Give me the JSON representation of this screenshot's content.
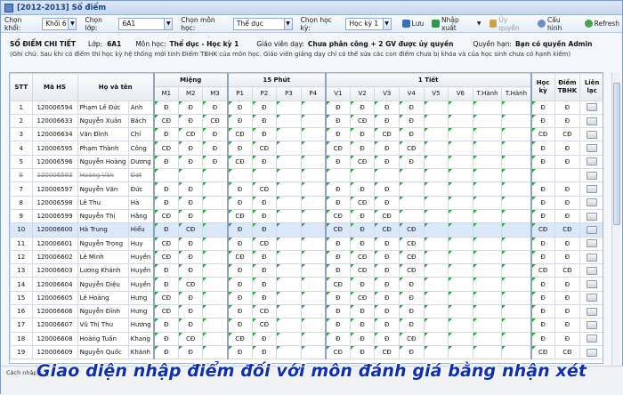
{
  "window": {
    "title": "[2012-2013] Sổ điểm"
  },
  "toolbar": {
    "khoi_label": "Chọn khối:",
    "khoi_value": "Khối 6",
    "lop_label": "Chọn lớp:",
    "lop_value": "6A1",
    "mon_label": "Chọn môn học:",
    "mon_value": "Thể dục",
    "hk_label": "Chọn học kỳ:",
    "hk_value": "Học kỳ 1",
    "save_label": "Lưu",
    "import_label": "Nhập xuất",
    "delegate_label": "Ủy quyền",
    "config_label": "Cấu hình",
    "refresh_label": "Refresh"
  },
  "info": {
    "heading": "SỔ ĐIỂM CHI TIẾT",
    "lop_label": "Lớp:",
    "lop_value": "6A1",
    "mon_label": "Môn học:",
    "mon_value": "Thể dục - Học kỳ 1",
    "gv_label": "Giáo viên dạy:",
    "gv_value": "Chưa phân công + 2 GV được ủy quyền",
    "quyen_label": "Quyền hạn:",
    "quyen_value": "Bạn có quyền Admin",
    "note": "(Ghi chú: Sau khi có điểm thi học kỳ hệ thống mới tính Điểm TBHK của môn học. Giáo viên giảng dạy chỉ có thể sửa các con điểm chưa bị khóa và của học sinh chưa có hạnh kiểm)"
  },
  "table": {
    "groups": {
      "stt": "STT",
      "mahs": "Mã HS",
      "hoten": "Họ và tên",
      "mieng": "Miệng",
      "phut15": "15 Phút",
      "tiet1": "1 Tiết",
      "hocky": "Học kỳ",
      "tbhk": "Điểm TBHK",
      "lienlac": "Liên lạc"
    },
    "sub": [
      "M1",
      "M2",
      "M3",
      "P1",
      "P2",
      "P3",
      "P4",
      "V1",
      "V2",
      "V3",
      "V4",
      "V5",
      "V6",
      "T.Hành",
      "T.Hành"
    ],
    "rows": [
      {
        "stt": "1",
        "ma": "120006594",
        "ho": "Phạm Lê Đức",
        "ten": "Anh",
        "sc": [
          "Đ",
          "Đ",
          "Đ",
          "Đ",
          "Đ",
          "",
          "",
          "Đ",
          "Đ",
          "Đ",
          "Đ",
          "",
          "",
          "",
          ""
        ],
        "hk": "Đ",
        "tb": "Đ"
      },
      {
        "stt": "2",
        "ma": "120006633",
        "ho": "Nguyễn Xuân",
        "ten": "Bách",
        "sc": [
          "CĐ",
          "Đ",
          "CĐ",
          "Đ",
          "Đ",
          "",
          "",
          "Đ",
          "CĐ",
          "Đ",
          "Đ",
          "",
          "",
          "",
          ""
        ],
        "hk": "Đ",
        "tb": "Đ"
      },
      {
        "stt": "3",
        "ma": "120006634",
        "ho": "Văn Đình",
        "ten": "Chí",
        "sc": [
          "Đ",
          "CĐ",
          "Đ",
          "CĐ",
          "Đ",
          "",
          "",
          "Đ",
          "Đ",
          "CĐ",
          "Đ",
          "",
          "",
          "",
          ""
        ],
        "hk": "CĐ",
        "tb": "CĐ"
      },
      {
        "stt": "4",
        "ma": "120006595",
        "ho": "Phạm Thành",
        "ten": "Công",
        "sc": [
          "CĐ",
          "Đ",
          "Đ",
          "Đ",
          "CĐ",
          "",
          "",
          "CĐ",
          "Đ",
          "Đ",
          "CĐ",
          "",
          "",
          "",
          ""
        ],
        "hk": "Đ",
        "tb": "Đ"
      },
      {
        "stt": "5",
        "ma": "120006596",
        "ho": "Nguyễn Hoàng",
        "ten": "Dương",
        "sc": [
          "Đ",
          "Đ",
          "Đ",
          "CĐ",
          "Đ",
          "",
          "",
          "Đ",
          "CĐ",
          "Đ",
          "Đ",
          "",
          "",
          "",
          ""
        ],
        "hk": "Đ",
        "tb": "Đ"
      },
      {
        "stt": "6",
        "ma": "120006593",
        "ho": "Hoàng Văn",
        "ten": "Đạt",
        "sc": [
          "",
          "",
          "",
          "",
          "",
          "",
          "",
          "",
          "",
          "",
          "",
          "",
          "",
          "",
          ""
        ],
        "hk": "",
        "tb": "",
        "strike": true
      },
      {
        "stt": "7",
        "ma": "120006597",
        "ho": "Nguyễn Văn",
        "ten": "Đức",
        "sc": [
          "Đ",
          "Đ",
          "",
          "Đ",
          "CĐ",
          "",
          "",
          "Đ",
          "Đ",
          "Đ",
          "",
          "",
          "",
          "",
          ""
        ],
        "hk": "Đ",
        "tb": "Đ"
      },
      {
        "stt": "8",
        "ma": "120006598",
        "ho": "Lê Thu",
        "ten": "Hà",
        "sc": [
          "Đ",
          "Đ",
          "",
          "Đ",
          "Đ",
          "",
          "",
          "Đ",
          "CĐ",
          "Đ",
          "",
          "",
          "",
          "",
          ""
        ],
        "hk": "Đ",
        "tb": "Đ"
      },
      {
        "stt": "9",
        "ma": "120006599",
        "ho": "Nguyễn Thị",
        "ten": "Hằng",
        "sc": [
          "CĐ",
          "Đ",
          "",
          "CĐ",
          "Đ",
          "",
          "",
          "CĐ",
          "Đ",
          "CĐ",
          "",
          "",
          "",
          "",
          ""
        ],
        "hk": "Đ",
        "tb": "Đ"
      },
      {
        "stt": "10",
        "ma": "120006600",
        "ho": "Hà Trung",
        "ten": "Hiếu",
        "sc": [
          "Đ",
          "CĐ",
          "",
          "Đ",
          "Đ",
          "",
          "",
          "CĐ",
          "Đ",
          "CĐ",
          "CĐ",
          "",
          "",
          "",
          ""
        ],
        "hk": "CĐ",
        "tb": "CĐ",
        "selected": true
      },
      {
        "stt": "11",
        "ma": "120006601",
        "ho": "Nguyễn Trọng",
        "ten": "Huy",
        "sc": [
          "CĐ",
          "Đ",
          "",
          "Đ",
          "CĐ",
          "",
          "",
          "Đ",
          "Đ",
          "Đ",
          "CĐ",
          "",
          "",
          "",
          ""
        ],
        "hk": "Đ",
        "tb": "Đ"
      },
      {
        "stt": "12",
        "ma": "120006602",
        "ho": "Lê Minh",
        "ten": "Huyền",
        "sc": [
          "CĐ",
          "Đ",
          "",
          "CĐ",
          "Đ",
          "",
          "",
          "Đ",
          "CĐ",
          "Đ",
          "CĐ",
          "",
          "",
          "",
          ""
        ],
        "hk": "Đ",
        "tb": "Đ"
      },
      {
        "stt": "13",
        "ma": "120006603",
        "ho": "Lương Khánh",
        "ten": "Huyền",
        "sc": [
          "Đ",
          "Đ",
          "",
          "Đ",
          "Đ",
          "",
          "",
          "Đ",
          "CĐ",
          "Đ",
          "CĐ",
          "",
          "",
          "",
          ""
        ],
        "hk": "CĐ",
        "tb": "CĐ"
      },
      {
        "stt": "14",
        "ma": "120006604",
        "ho": "Nguyễn Diệu",
        "ten": "Huyền",
        "sc": [
          "Đ",
          "CĐ",
          "",
          "Đ",
          "Đ",
          "",
          "",
          "CĐ",
          "Đ",
          "Đ",
          "Đ",
          "",
          "",
          "",
          ""
        ],
        "hk": "Đ",
        "tb": "Đ"
      },
      {
        "stt": "15",
        "ma": "120006605",
        "ho": "Lê Hoàng",
        "ten": "Hưng",
        "sc": [
          "CĐ",
          "Đ",
          "",
          "Đ",
          "Đ",
          "",
          "",
          "Đ",
          "CĐ",
          "Đ",
          "Đ",
          "",
          "",
          "",
          ""
        ],
        "hk": "Đ",
        "tb": "Đ"
      },
      {
        "stt": "16",
        "ma": "120006606",
        "ho": "Nguyễn Đình",
        "ten": "Hưng",
        "sc": [
          "CĐ",
          "Đ",
          "",
          "Đ",
          "CĐ",
          "",
          "",
          "Đ",
          "Đ",
          "Đ",
          "Đ",
          "",
          "",
          "",
          ""
        ],
        "hk": "Đ",
        "tb": "Đ"
      },
      {
        "stt": "17",
        "ma": "120006607",
        "ho": "Vũ Thị Thu",
        "ten": "Hương",
        "sc": [
          "Đ",
          "Đ",
          "",
          "Đ",
          "CĐ",
          "",
          "",
          "Đ",
          "Đ",
          "Đ",
          "Đ",
          "",
          "",
          "",
          ""
        ],
        "hk": "Đ",
        "tb": "Đ"
      },
      {
        "stt": "18",
        "ma": "120006608",
        "ho": "Hoàng Tuấn",
        "ten": "Khang",
        "sc": [
          "Đ",
          "CĐ",
          "",
          "CĐ",
          "Đ",
          "",
          "",
          "Đ",
          "Đ",
          "Đ",
          "CĐ",
          "",
          "",
          "",
          ""
        ],
        "hk": "Đ",
        "tb": "Đ"
      },
      {
        "stt": "19",
        "ma": "120006609",
        "ho": "Nguyễn Quốc",
        "ten": "Khánh",
        "sc": [
          "Đ",
          "Đ",
          "",
          "Đ",
          "Đ",
          "",
          "",
          "CĐ",
          "Đ",
          "CĐ",
          "Đ",
          "",
          "",
          "",
          ""
        ],
        "hk": "CĐ",
        "tb": "CĐ"
      }
    ]
  },
  "status": {
    "hint": "Cách nhập b"
  },
  "caption": "Giao diện nhập điểm đối với môn đánh giá bằng nhận xét"
}
